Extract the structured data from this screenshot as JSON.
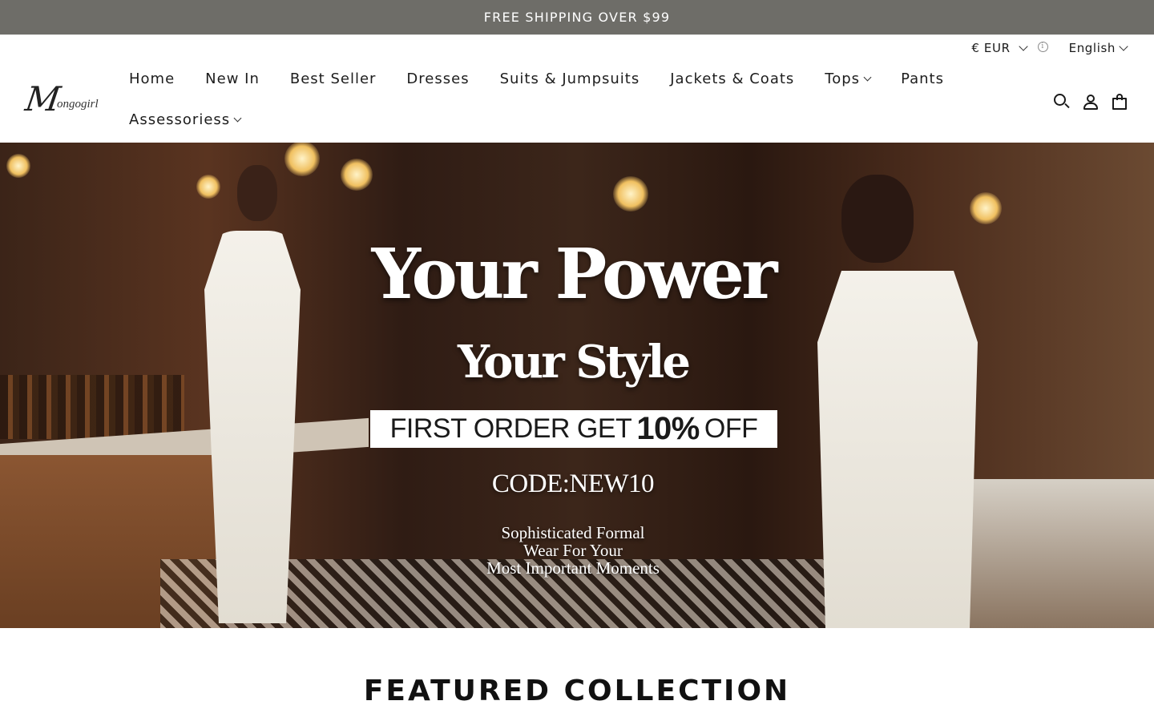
{
  "announcement": "FREE SHIPPING OVER $99",
  "utility": {
    "currency": "€ EUR",
    "language": "English"
  },
  "brand": {
    "logo_initial": "M",
    "logo_rest": "ongogirl"
  },
  "nav": [
    {
      "label": "Home",
      "dropdown": false
    },
    {
      "label": "New In",
      "dropdown": false
    },
    {
      "label": "Best Seller",
      "dropdown": false
    },
    {
      "label": "Dresses",
      "dropdown": false
    },
    {
      "label": "Suits & Jumpsuits",
      "dropdown": false
    },
    {
      "label": "Jackets & Coats",
      "dropdown": false
    },
    {
      "label": "Tops",
      "dropdown": true
    },
    {
      "label": "Pants",
      "dropdown": false
    },
    {
      "label": "Assessoriess",
      "dropdown": true
    }
  ],
  "hero": {
    "headline": "Your Power",
    "subheadline": "Your Style",
    "offer_prefix": "FIRST ORDER GET",
    "offer_value": "10%",
    "offer_suffix": "OFF",
    "code": "CODE:NEW10",
    "tagline_1": "Sophisticated Formal",
    "tagline_2": "Wear For Your",
    "tagline_3": "Most Important Moments"
  },
  "featured_title": "FEATURED COLLECTION"
}
